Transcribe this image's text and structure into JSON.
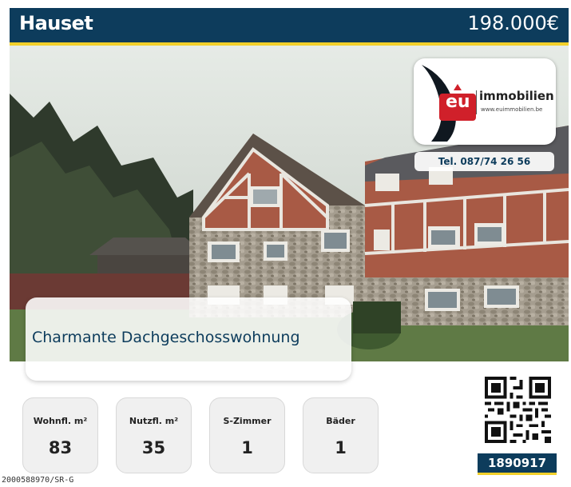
{
  "header": {
    "city": "Hauset",
    "price": "198.000€"
  },
  "agency": {
    "logo_text": "eu",
    "name": "immobilien",
    "website": "www.euimmobilien.be",
    "phone": "Tel. 087/74 26 56"
  },
  "listing": {
    "title": "Charmante Dachgeschosswohnung",
    "reference": "1890917"
  },
  "stats": [
    {
      "label": "Wohnfl. m²",
      "value": "83"
    },
    {
      "label": "Nutzfl. m²",
      "value": "35"
    },
    {
      "label": "S-Zimmer",
      "value": "1"
    },
    {
      "label": "Bäder",
      "value": "1"
    }
  ],
  "footer": {
    "code": "2000588970/SR-G"
  },
  "colors": {
    "brand_blue": "#0d3c5c",
    "accent_yellow": "#f2d02a",
    "logo_red": "#d0202a"
  },
  "icons": {
    "qr": "qr-code-icon"
  }
}
